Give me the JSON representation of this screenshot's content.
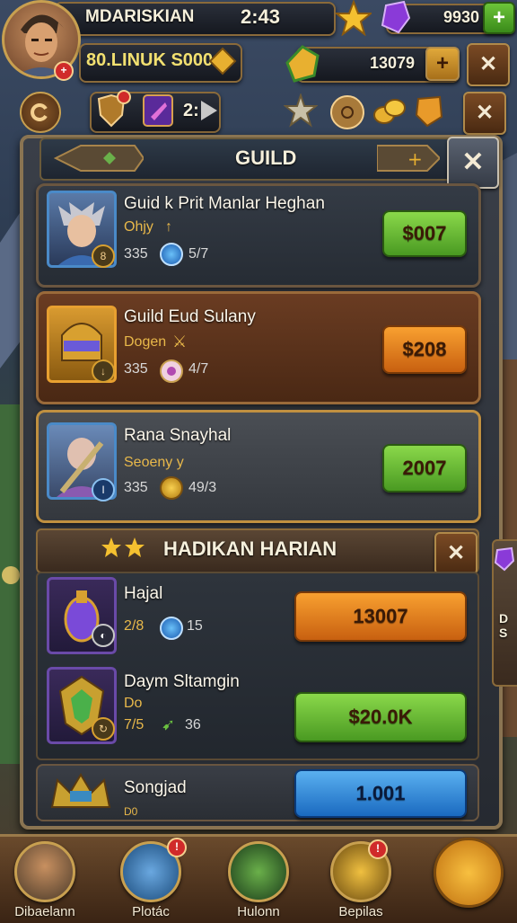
{
  "player": {
    "name": "MDARISKIAN",
    "time": "2:43",
    "gold_line": "80.LINUK S000"
  },
  "currencies": {
    "gems": "9930",
    "gold": "13079",
    "counter": "2:"
  },
  "guild_panel": {
    "title": "GUILD",
    "members": [
      {
        "name": "Guid k Prit Manlar Heghan",
        "role": "Ohjy",
        "role_mark": "↑",
        "level": "335",
        "stat": "5/7",
        "button": "$007"
      },
      {
        "name": "Guild Eud Sulany",
        "role": "Dogen",
        "level": "335",
        "stat": "4/7",
        "button": "$208"
      },
      {
        "name": "Rana Snayhal",
        "role": "Seoeny y",
        "level": "335",
        "stat": "49/3",
        "button": "2007"
      }
    ]
  },
  "daily_panel": {
    "title": "HADIKAN HARIAN",
    "items": [
      {
        "name": "Hajal",
        "level": "2/8",
        "stat": "15",
        "button": "13007"
      },
      {
        "name": "Daym Sltamgin",
        "role": "Do",
        "level": "7/5",
        "stat": "36",
        "button": "$20.0K"
      },
      {
        "name": "Songjad",
        "role": "D0",
        "button": "1.001"
      }
    ]
  },
  "side_tab": {
    "label": "D S"
  },
  "bottom_nav": [
    {
      "label": "Dibaelann",
      "badge": ""
    },
    {
      "label": "Plotác",
      "badge": "!"
    },
    {
      "label": "Hulonn",
      "badge": ""
    },
    {
      "label": "Bepilas",
      "badge": "!"
    },
    {
      "label": ""
    }
  ],
  "colors": {
    "accent_gold": "#c8a050",
    "button_green": "#6cc43a",
    "button_orange": "#f08a20",
    "button_blue": "#3a90e0",
    "panel_border": "#8a7452"
  }
}
